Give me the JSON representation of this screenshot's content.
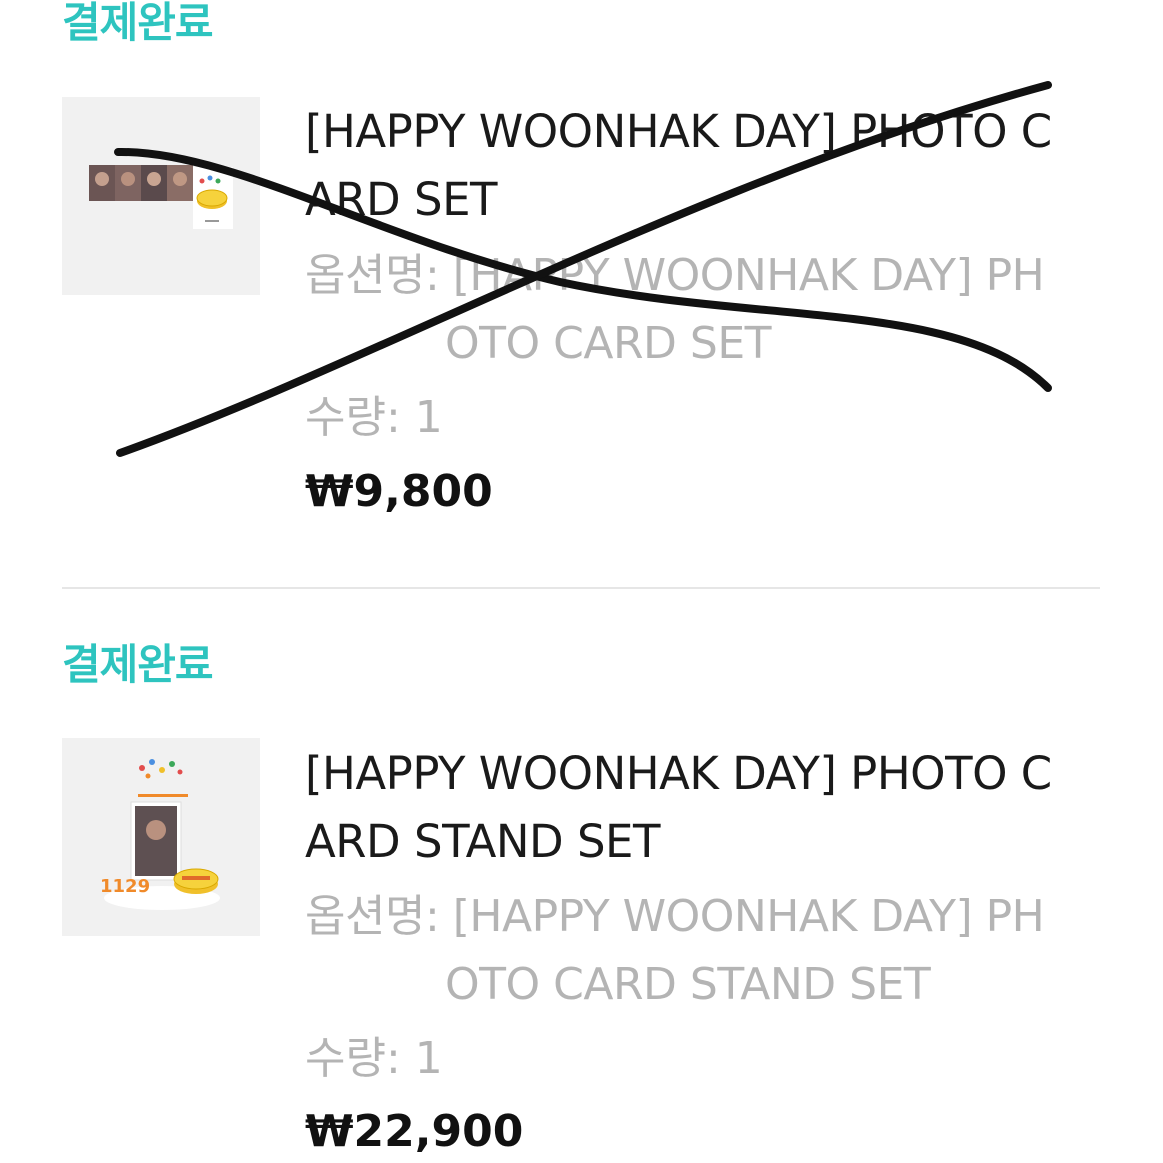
{
  "colors": {
    "status": "#2ec4bf",
    "option_text": "#b4b4b4",
    "title_text": "#1a1a1a",
    "price_text": "#111111",
    "thumb_bg": "#f1f1f1",
    "divider": "#e6e6e6",
    "scribble": "#111111"
  },
  "orders": [
    {
      "status": "결제완료",
      "title_line1": "[HAPPY WOONHAK DAY] PHOTO C",
      "title_line2": "ARD SET",
      "option_label": "옵션명:",
      "option_value_line1": "[HAPPY WOONHAK DAY] PH",
      "option_value_line2": "OTO CARD SET",
      "quantity": "수량: 1",
      "price": "₩9,800",
      "thumbnail_icon": "photo-card-set-thumbnail",
      "crossed_out": true
    },
    {
      "status": "결제완료",
      "title_line1": "[HAPPY WOONHAK DAY] PHOTO C",
      "title_line2": "ARD STAND SET",
      "option_label": "옵션명:",
      "option_value_line1": "[HAPPY WOONHAK DAY] PH",
      "option_value_line2": "OTO CARD STAND SET",
      "quantity": "수량: 1",
      "price": "₩22,900",
      "thumbnail_icon": "photo-card-stand-set-thumbnail",
      "thumbnail_text": "1129",
      "crossed_out": false
    }
  ]
}
